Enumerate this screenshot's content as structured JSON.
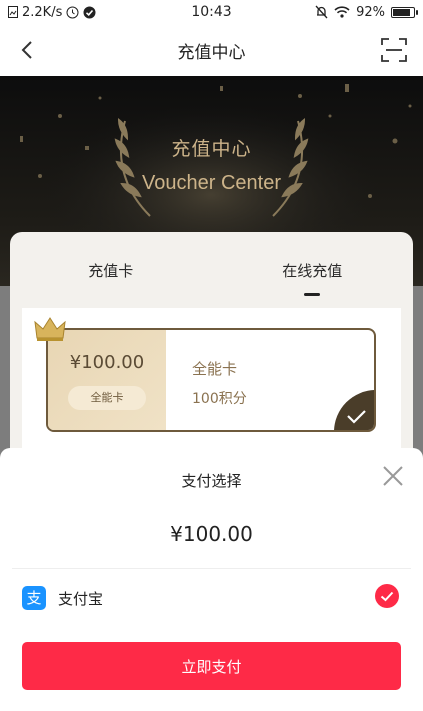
{
  "status_bar": {
    "network_speed": "2.2K/s",
    "time": "10:43",
    "battery_percent_text": "92%",
    "battery_level": 0.92
  },
  "nav": {
    "title": "充值中心"
  },
  "banner": {
    "title": "充值中心",
    "subtitle": "Voucher Center"
  },
  "tabs": [
    {
      "label": "充值卡",
      "active": false
    },
    {
      "label": "在线充值",
      "active": true
    }
  ],
  "voucher": {
    "price": "¥100.00",
    "tag": "全能卡",
    "name": "全能卡",
    "points": "100积分"
  },
  "payment_sheet": {
    "title": "支付选择",
    "amount": "¥100.00",
    "method_label": "支付宝",
    "method_icon_glyph": "支",
    "pay_button_label": "立即支付"
  },
  "colors": {
    "accent_red": "#fe2a47",
    "gold": "#cdb48a",
    "alipay_blue": "#1a93ff"
  }
}
